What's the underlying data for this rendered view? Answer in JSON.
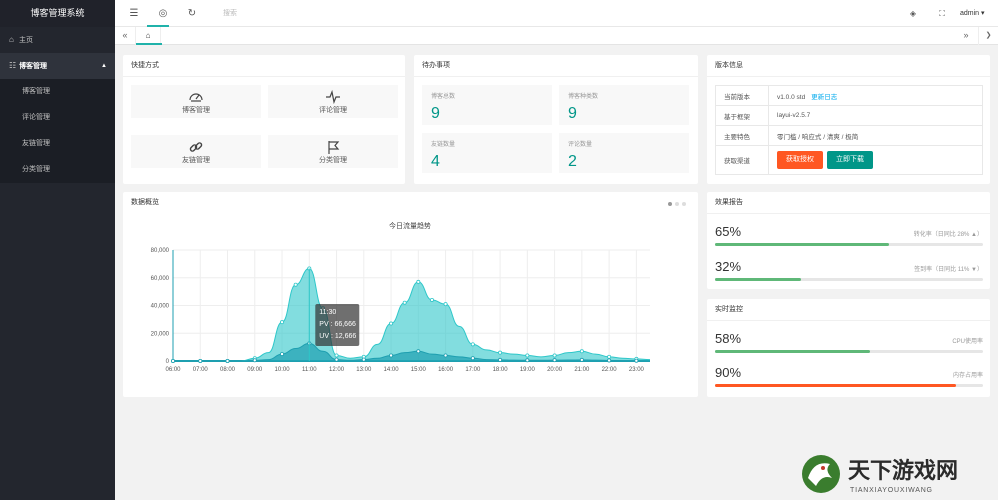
{
  "app": {
    "title": "博客管理系统"
  },
  "sidebar": {
    "items": [
      {
        "label": "主页",
        "icon": "home-icon"
      },
      {
        "label": "博客管理",
        "icon": "layers-icon",
        "expanded": true
      },
      {
        "label": "博客管理"
      },
      {
        "label": "评论管理"
      },
      {
        "label": "友链管理"
      },
      {
        "label": "分类管理"
      }
    ]
  },
  "topbar": {
    "menu_icon": "menu-icon",
    "globe_icon": "globe-icon",
    "refresh_icon": "refresh-icon",
    "search_label": "搜索",
    "clear_icon": "clear-icon",
    "fullscreen_icon": "fullscreen-icon",
    "user": "admin ▾"
  },
  "tabs": {
    "prev": "«",
    "next": "»",
    "menu": "❯"
  },
  "quick": {
    "title": "快捷方式",
    "items": [
      {
        "label": "博客管理",
        "icon": "dashboard-icon"
      },
      {
        "label": "评论管理",
        "icon": "pulse-icon"
      },
      {
        "label": "友链管理",
        "icon": "link-icon"
      },
      {
        "label": "分类管理",
        "icon": "flag-icon"
      }
    ]
  },
  "todo": {
    "title": "待办事项",
    "items": [
      {
        "label": "博客总数",
        "value": "9"
      },
      {
        "label": "博客种类数",
        "value": "9"
      },
      {
        "label": "友链数量",
        "value": "4"
      },
      {
        "label": "评论数量",
        "value": "2"
      }
    ]
  },
  "version": {
    "title": "版本信息",
    "rows": [
      {
        "k": "当前版本",
        "v": "v1.0.0 std",
        "link": "更新日志"
      },
      {
        "k": "基于框架",
        "v": "layui-v2.5.7"
      },
      {
        "k": "主要特色",
        "v": "零门槛 / 响应式 / 清爽 / 极简"
      },
      {
        "k": "获取渠道"
      }
    ],
    "btn_auth": "获取授权",
    "btn_download": "立即下载"
  },
  "overview": {
    "title": "数据概览"
  },
  "report": {
    "title": "效果报告",
    "items": [
      {
        "pct": "65%",
        "desc": "转化率（日同比 28% ▲）",
        "value": 0.65,
        "color": "#5fb878"
      },
      {
        "pct": "32%",
        "desc": "签到率（日同比 11% ▼）",
        "value": 0.32,
        "color": "#5fb878"
      }
    ]
  },
  "monitor": {
    "title": "实时监控",
    "items": [
      {
        "pct": "58%",
        "desc": "CPU使用率",
        "value": 0.58,
        "color": "#5fb878"
      },
      {
        "pct": "90%",
        "desc": "内存占用率",
        "value": 0.9,
        "color": "#ff5722"
      }
    ]
  },
  "chart_data": {
    "type": "area",
    "title": "今日流量趋势",
    "x": [
      "06:00",
      "06:30",
      "07:00",
      "07:30",
      "08:00",
      "08:30",
      "09:00",
      "09:30",
      "10:00",
      "10:30",
      "11:00",
      "11:30",
      "12:00",
      "12:30",
      "13:00",
      "13:30",
      "14:00",
      "14:30",
      "15:00",
      "15:30",
      "16:00",
      "16:30",
      "17:00",
      "17:30",
      "18:00",
      "18:30",
      "19:00",
      "19:30",
      "20:00",
      "20:30",
      "21:00",
      "21:30",
      "22:00",
      "22:30",
      "23:00",
      "23:30"
    ],
    "xticks": [
      "06:00",
      "07:00",
      "08:00",
      "09:00",
      "10:00",
      "11:00",
      "12:00",
      "13:00",
      "14:00",
      "15:00",
      "16:00",
      "17:00",
      "18:00",
      "19:00",
      "20:00",
      "21:00",
      "22:00",
      "23:00"
    ],
    "yticks": [
      "0",
      "20,000",
      "40,000",
      "60,000",
      "80,000"
    ],
    "ylim": [
      0,
      80000
    ],
    "series": [
      {
        "name": "PV",
        "color": "#2ec7c9",
        "values": [
          0,
          0,
          0,
          0,
          0,
          0,
          2000,
          6000,
          28000,
          55000,
          66666,
          38000,
          4000,
          2000,
          3000,
          12000,
          27000,
          42000,
          57000,
          44000,
          41000,
          25000,
          12000,
          8000,
          6000,
          5000,
          4000,
          3000,
          4000,
          6000,
          7000,
          5000,
          3000,
          2000,
          1500,
          1000
        ]
      },
      {
        "name": "UV",
        "color": "#1e9fb0",
        "values": [
          0,
          0,
          0,
          0,
          0,
          0,
          500,
          1000,
          5000,
          9000,
          12666,
          7000,
          1000,
          500,
          1000,
          2000,
          4000,
          6000,
          7000,
          5000,
          4000,
          3000,
          2000,
          1000,
          800,
          600,
          500,
          500,
          600,
          700,
          800,
          600,
          400,
          300,
          200,
          100
        ]
      }
    ],
    "tooltip": {
      "time": "11:30",
      "pv": "PV : 66,666",
      "uv": "UV : 12,666"
    }
  },
  "watermark": {
    "text": "天下游戏网",
    "sub": "TIANXIAYOUXIWANG"
  }
}
